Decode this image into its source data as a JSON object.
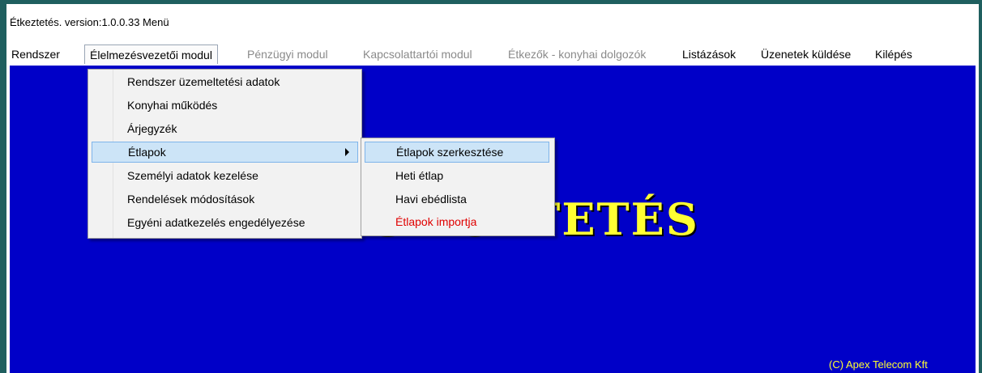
{
  "window": {
    "title": "Étkeztetés. version:1.0.0.33 Menü"
  },
  "menubar": {
    "items": [
      {
        "label": "Rendszer",
        "enabled": true
      },
      {
        "label": "Élelmezésvezetői modul",
        "enabled": true,
        "open": true
      },
      {
        "label": "Pénzügyi modul",
        "enabled": false
      },
      {
        "label": "Kapcsolattartói modul",
        "enabled": false
      },
      {
        "label": "Étkezők - konyhai dolgozók",
        "enabled": false
      },
      {
        "label": "Listázások",
        "enabled": true
      },
      {
        "label": "Üzenetek küldése",
        "enabled": true
      },
      {
        "label": "Kilépés",
        "enabled": true
      }
    ]
  },
  "dropdown": {
    "items": [
      {
        "label": "Rendszer üzemeltetési adatok"
      },
      {
        "label": "Konyhai működés"
      },
      {
        "label": "Árjegyzék"
      },
      {
        "label": "Étlapok",
        "has_submenu": true,
        "highlighted": true
      },
      {
        "label": "Személyi adatok kezelése"
      },
      {
        "label": "Rendelések módosítások"
      },
      {
        "label": "Egyéni adatkezelés engedélyezése"
      }
    ]
  },
  "submenu": {
    "items": [
      {
        "label": "Étlapok szerkesztése",
        "highlighted": true
      },
      {
        "label": "Heti étlap"
      },
      {
        "label": "Havi ebédlista"
      },
      {
        "label": "Étlapok importja",
        "color": "#e00000"
      }
    ]
  },
  "background": {
    "title_visible": "ZOZOSMOZTETÉS",
    "copyright": "(C) Apex Telecom Kft"
  },
  "colors": {
    "client_bg": "#0000c8",
    "title_yellow": "#ffff33",
    "highlight_bg": "#cce4f7",
    "highlight_border": "#7eb4ea",
    "disabled_text": "#8a8a8a",
    "import_red": "#e00000"
  }
}
